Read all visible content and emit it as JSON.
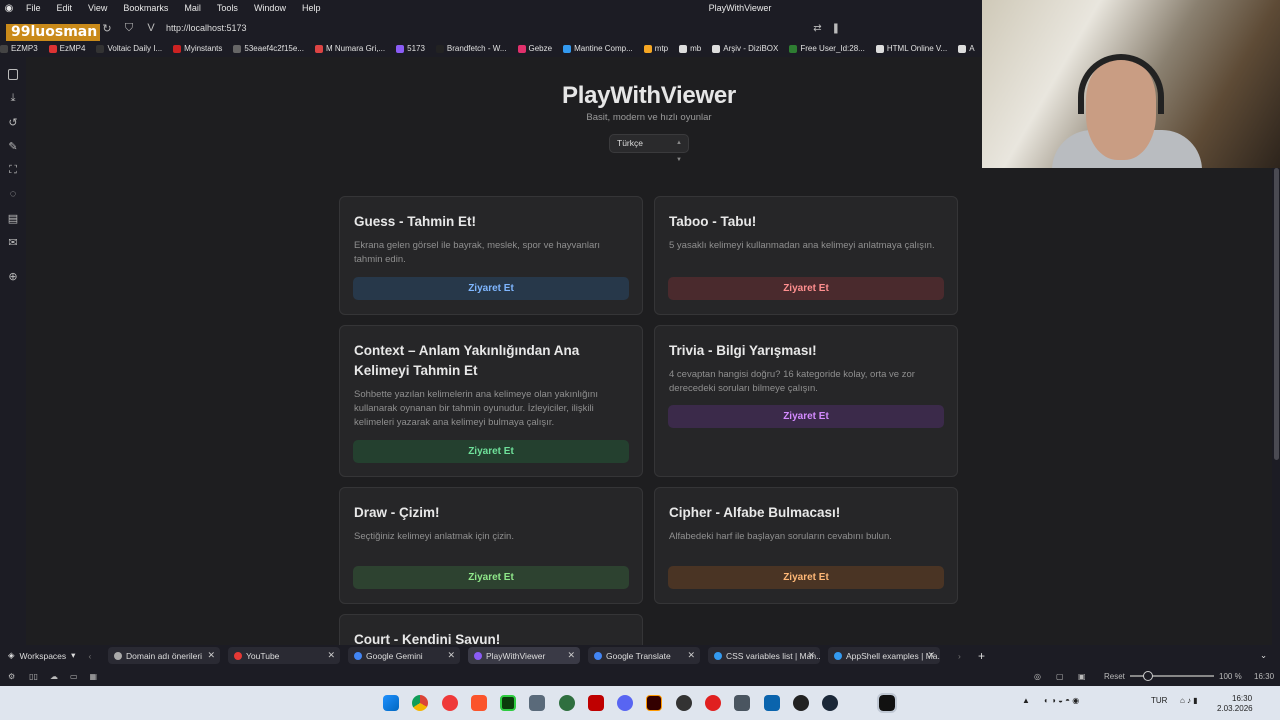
{
  "window": {
    "title": "PlayWithViewer",
    "menu": [
      "File",
      "Edit",
      "View",
      "Bookmarks",
      "Mail",
      "Tools",
      "Window",
      "Help"
    ]
  },
  "address_bar": {
    "url": "http://localhost:5173"
  },
  "brand_overlay": "99luosman",
  "bookmarks": [
    {
      "label": "EZMP3",
      "color": "#444"
    },
    {
      "label": "EzMP4",
      "color": "#d33"
    },
    {
      "label": "Voltaic Daily I...",
      "color": "#333"
    },
    {
      "label": "Myinstants",
      "color": "#c22"
    },
    {
      "label": "53eaef4c2f15e...",
      "color": "#666"
    },
    {
      "label": "M Numara Gri,...",
      "color": "#d44"
    },
    {
      "label": "5173",
      "color": "#8b5cf6"
    },
    {
      "label": "Brandfetch - W...",
      "color": "#222"
    },
    {
      "label": "Gebze",
      "color": "#e1306c"
    },
    {
      "label": "Mantine Comp...",
      "color": "#339af0"
    },
    {
      "label": "mtp",
      "color": "#f5a623"
    },
    {
      "label": "mb",
      "color": "#ddd"
    },
    {
      "label": "Arşiv - DiziBOX",
      "color": "#ddd"
    },
    {
      "label": "Free User_Id:28...",
      "color": "#2e7d32"
    },
    {
      "label": "HTML Online V...",
      "color": "#ddd"
    },
    {
      "label": "A",
      "color": "#ddd"
    }
  ],
  "hero": {
    "title": "PlayWithViewer",
    "subtitle": "Basit, modern ve hızlı oyunlar",
    "language": "Türkçe"
  },
  "cards": [
    {
      "title": "Guess - Tahmin Et!",
      "desc": "Ekrana gelen görsel ile bayrak, meslek, spor ve hayvanları tahmin edin.",
      "button": "Ziyaret Et",
      "btn_bg": "#27384a",
      "btn_fg": "#7fb6ff"
    },
    {
      "title": "Taboo - Tabu!",
      "desc": "5 yasaklı kelimeyi kullanmadan ana kelimeyi anlatmaya çalışın.",
      "button": "Ziyaret Et",
      "btn_bg": "#4a2a2d",
      "btn_fg": "#ff8f8f"
    },
    {
      "title": "Context – Anlam Yakınlığından Ana Kelimeyi Tahmin Et",
      "desc": "Sohbette yazılan kelimelerin ana kelimeye olan yakınlığını kullanarak oynanan bir tahmin oyunudur. İzleyiciler, ilişkili kelimeleri yazarak ana kelimeyi bulmaya çalışır.",
      "button": "Ziyaret Et",
      "btn_bg": "#24402f",
      "btn_fg": "#6fe09a"
    },
    {
      "title": "Trivia - Bilgi Yarışması!",
      "desc": "4 cevaptan hangisi doğru? 16 kategoride kolay, orta ve zor derecedeki soruları bilmeye çalışın.",
      "button": "Ziyaret Et",
      "btn_bg": "#3b2a4a",
      "btn_fg": "#d48bff"
    },
    {
      "title": "Draw - Çizim!",
      "desc": "Seçtiğiniz kelimeyi anlatmak için çizin.",
      "button": "Ziyaret Et",
      "btn_bg": "#2d4230",
      "btn_fg": "#8fe88a"
    },
    {
      "title": "Cipher - Alfabe Bulmacası!",
      "desc": "Alfabedeki harf ile başlayan soruların cevabını bulun.",
      "button": "Ziyaret Et",
      "btn_bg": "#4a3424",
      "btn_fg": "#ffb877"
    },
    {
      "title": "Court - Kendini Savun!",
      "desc": "",
      "button": "",
      "btn_bg": "",
      "btn_fg": ""
    }
  ],
  "tabs": {
    "workspaces": "Workspaces",
    "items": [
      {
        "label": "Domain adı önerileri",
        "color": "#aaa",
        "active": false
      },
      {
        "label": "YouTube",
        "color": "#e53935",
        "active": false
      },
      {
        "label": "Google Gemini",
        "color": "#4285f4",
        "active": false
      },
      {
        "label": "PlayWithViewer",
        "color": "#8b5cf6",
        "active": true
      },
      {
        "label": "Google Translate",
        "color": "#4285f4",
        "active": false
      },
      {
        "label": "CSS variables list | Man...",
        "color": "#339af0",
        "active": false
      },
      {
        "label": "AppShell examples | Ma...",
        "color": "#339af0",
        "active": false
      }
    ]
  },
  "status": {
    "reset": "Reset",
    "zoom": "100 %",
    "time": "16:30"
  },
  "os": {
    "lang": "TUR",
    "time": "16:30",
    "date": "2.03.2026"
  }
}
